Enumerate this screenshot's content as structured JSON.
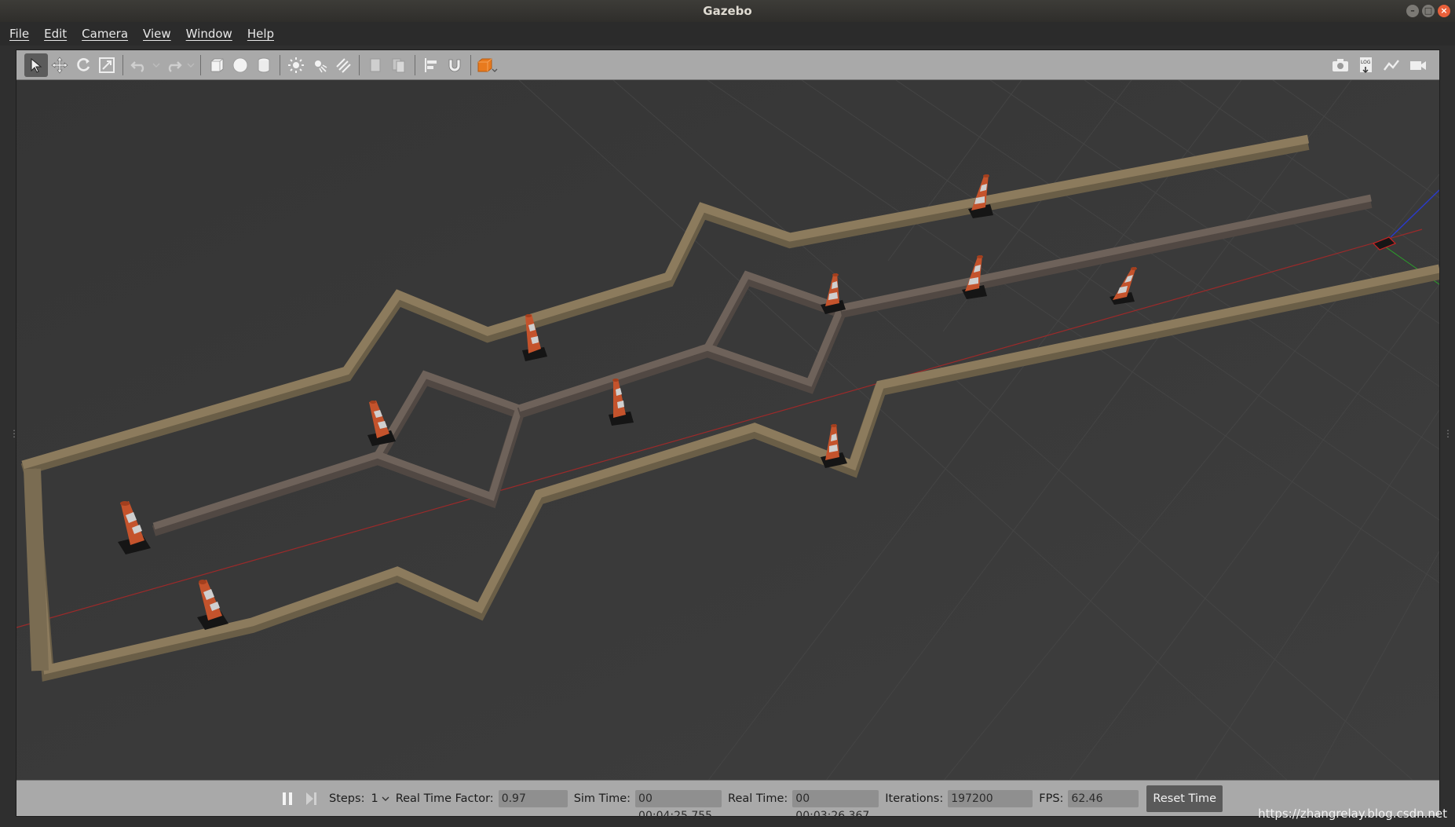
{
  "window": {
    "title": "Gazebo"
  },
  "menu": [
    "File",
    "Edit",
    "Camera",
    "View",
    "Window",
    "Help"
  ],
  "toolbar": {
    "left_icons": [
      "select-arrow-icon",
      "translate-icon",
      "rotate-icon",
      "scale-icon",
      "undo-icon",
      "undo-dropdown-icon",
      "redo-icon",
      "redo-dropdown-icon",
      "box-shape-icon",
      "sphere-shape-icon",
      "cylinder-shape-icon",
      "point-light-icon",
      "spot-light-icon",
      "directional-light-icon",
      "copy-icon",
      "paste-icon",
      "align-icon",
      "snap-magnet-icon",
      "view-angle-icon"
    ],
    "right_icons": [
      "screenshot-camera-icon",
      "log-icon",
      "plot-icon",
      "video-record-icon"
    ]
  },
  "bottom": {
    "steps_label": "Steps:",
    "steps_value": "1",
    "rtf_label": "Real Time Factor:",
    "rtf_value": "0.97",
    "sim_time_label": "Sim Time:",
    "sim_time_value": "00 00:04:25.755",
    "real_time_label": "Real Time:",
    "real_time_value": "00 00:03:26.367",
    "iterations_label": "Iterations:",
    "iterations_value": "197200",
    "fps_label": "FPS:",
    "fps_value": "62.46",
    "reset_label": "Reset Time"
  },
  "watermark": "https://zhangrelay.blog.csdn.net",
  "colors": {
    "outer_wall": "#8a7a5c",
    "inner_wall": "#6c6058",
    "cone": "#c8502a",
    "x_axis": "#b02a2a",
    "background": "#3a3a3a"
  }
}
